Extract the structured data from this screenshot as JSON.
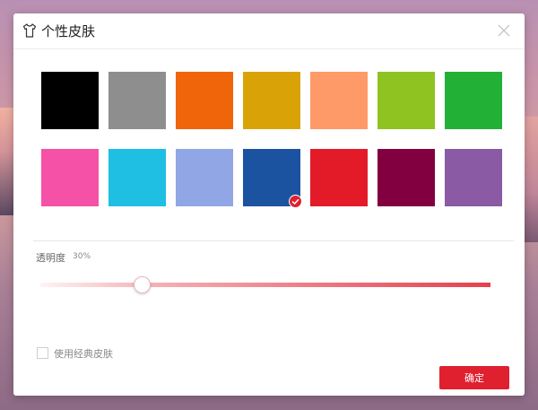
{
  "dialog": {
    "title": "个性皮肤",
    "title_icon": "tshirt-icon",
    "close_icon": "close-icon"
  },
  "swatches": [
    {
      "name": "black",
      "color": "#000000",
      "selected": false
    },
    {
      "name": "gray",
      "color": "#8e8e8e",
      "selected": false
    },
    {
      "name": "orange",
      "color": "#f0650a",
      "selected": false
    },
    {
      "name": "gold",
      "color": "#d9a307",
      "selected": false
    },
    {
      "name": "peach",
      "color": "#fd9a68",
      "selected": false
    },
    {
      "name": "lime",
      "color": "#8fc321",
      "selected": false
    },
    {
      "name": "green",
      "color": "#23b036",
      "selected": false
    },
    {
      "name": "pink",
      "color": "#f551a6",
      "selected": false
    },
    {
      "name": "cyan",
      "color": "#1fbee3",
      "selected": false
    },
    {
      "name": "lavender",
      "color": "#90a6e5",
      "selected": false
    },
    {
      "name": "blue",
      "color": "#1b53a0",
      "selected": true
    },
    {
      "name": "red",
      "color": "#e31b28",
      "selected": false
    },
    {
      "name": "maroon",
      "color": "#820040",
      "selected": false
    },
    {
      "name": "purple",
      "color": "#8a5aa4",
      "selected": false
    }
  ],
  "opacity": {
    "label": "透明度",
    "value_text": "30%",
    "value": 0.3
  },
  "classic_skin": {
    "label": "使用经典皮肤",
    "checked": false
  },
  "confirm_label": "确定",
  "accent_color": "#e0202f"
}
